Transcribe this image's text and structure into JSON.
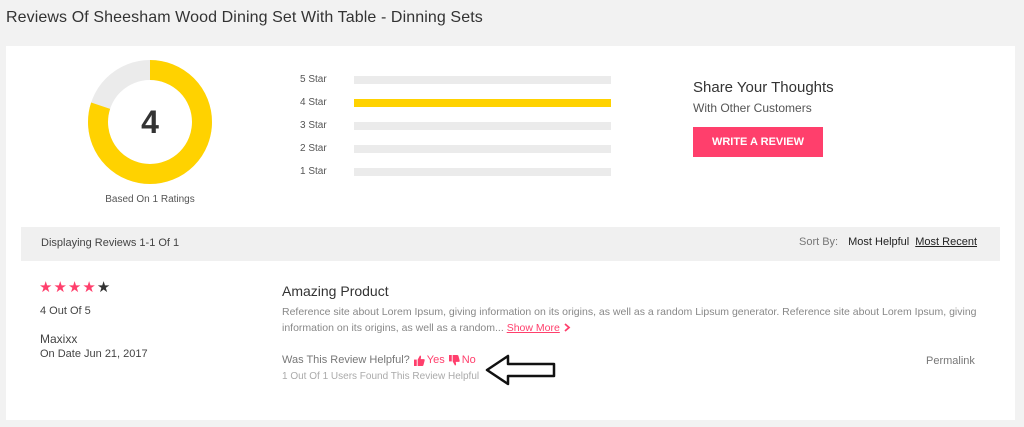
{
  "page": {
    "title": "Reviews Of Sheesham Wood Dining Set With Table - Dinning Sets"
  },
  "summary": {
    "average": "4",
    "based_on": "Based On 1 Ratings",
    "ring_fill_fraction": 0.8,
    "ring_color": "#ffd200",
    "ring_track_color": "#ebebeb"
  },
  "distribution": [
    {
      "label": "5 Star",
      "fraction": 0
    },
    {
      "label": "4 Star",
      "fraction": 1
    },
    {
      "label": "3 Star",
      "fraction": 0
    },
    {
      "label": "2 Star",
      "fraction": 0
    },
    {
      "label": "1 Star",
      "fraction": 0
    }
  ],
  "share": {
    "title": "Share Your Thoughts",
    "subtitle": "With Other Customers",
    "button_label": "WRITE A REVIEW",
    "button_color": "#ff3f6c"
  },
  "listing": {
    "displaying": "Displaying Reviews 1-1 Of 1",
    "sort_label": "Sort By:",
    "sort_options": [
      "Most Helpful",
      "Most Recent"
    ],
    "sort_active": "Most Recent"
  },
  "review": {
    "stars_filled": 4,
    "stars_total": 5,
    "rating_text": "4 Out Of 5",
    "reviewer": "Maxixx",
    "date": "On Date Jun 21, 2017",
    "title": "Amazing Product",
    "body": "Reference site about Lorem Ipsum, giving information on its origins, as well as a random Lipsum generator. Reference site about Lorem Ipsum, giving information on its origins, as well as a random...",
    "show_more": "Show More",
    "helpful_question": "Was This Review Helpful?",
    "yes_label": "Yes",
    "no_label": "No",
    "helpful_count": "1 Out Of 1 Users Found This Review Helpful",
    "permalink": "Permalink"
  },
  "icons": {
    "star": "star-icon",
    "thumbs_up": "thumbs-up-icon",
    "thumbs_down": "thumbs-down-icon",
    "chevron": "chevron-right-icon",
    "arrow": "left-arrow-annotation-icon"
  }
}
